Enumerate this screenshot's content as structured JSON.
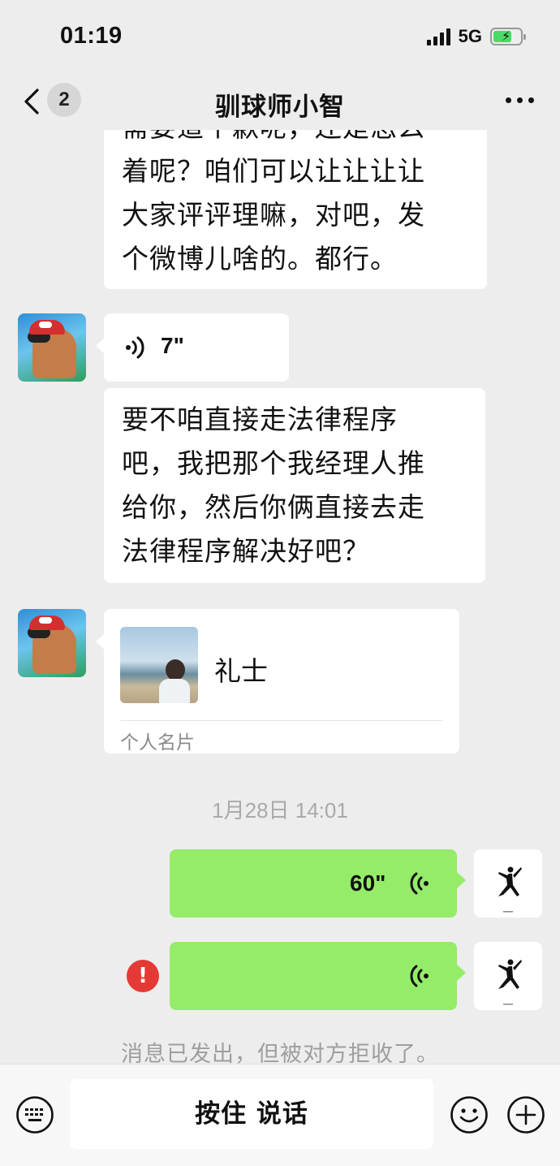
{
  "status_bar": {
    "time": "01:19",
    "network": "5G"
  },
  "nav": {
    "back_count": "2",
    "title": "驯球师小智"
  },
  "messages": {
    "cut_top_text": "需要道个歉呢，还是怎么",
    "text_1_lines": [
      "着呢？咱们可以让让让让",
      "大家评评理嘛，对吧，发",
      "个微博儿啥的。都行。"
    ],
    "voice_1_duration": "7\"",
    "text_2_lines": [
      "要不咱直接走法律程序",
      "吧，我把那个我经理人推",
      "给你，然后你俩直接去走",
      "法律程序解决好吧？"
    ],
    "card": {
      "name": "礼士",
      "label": "个人名片"
    },
    "timestamp": "1月28日 14:01",
    "voice_2_duration": "60\"",
    "error_mark": "!",
    "system_notice": "消息已发出，但被对方拒收了。"
  },
  "input_bar": {
    "hold_to_talk": "按住 说话"
  },
  "icons": [
    "back-chevron-icon",
    "more-icon",
    "voice-wave-icon",
    "keyboard-icon",
    "emoji-icon",
    "plus-icon",
    "jumpman-logo-icon"
  ],
  "colors": {
    "background": "#ededed",
    "bubble_self": "#95ec69",
    "bubble_other": "#ffffff",
    "error": "#e53935"
  }
}
